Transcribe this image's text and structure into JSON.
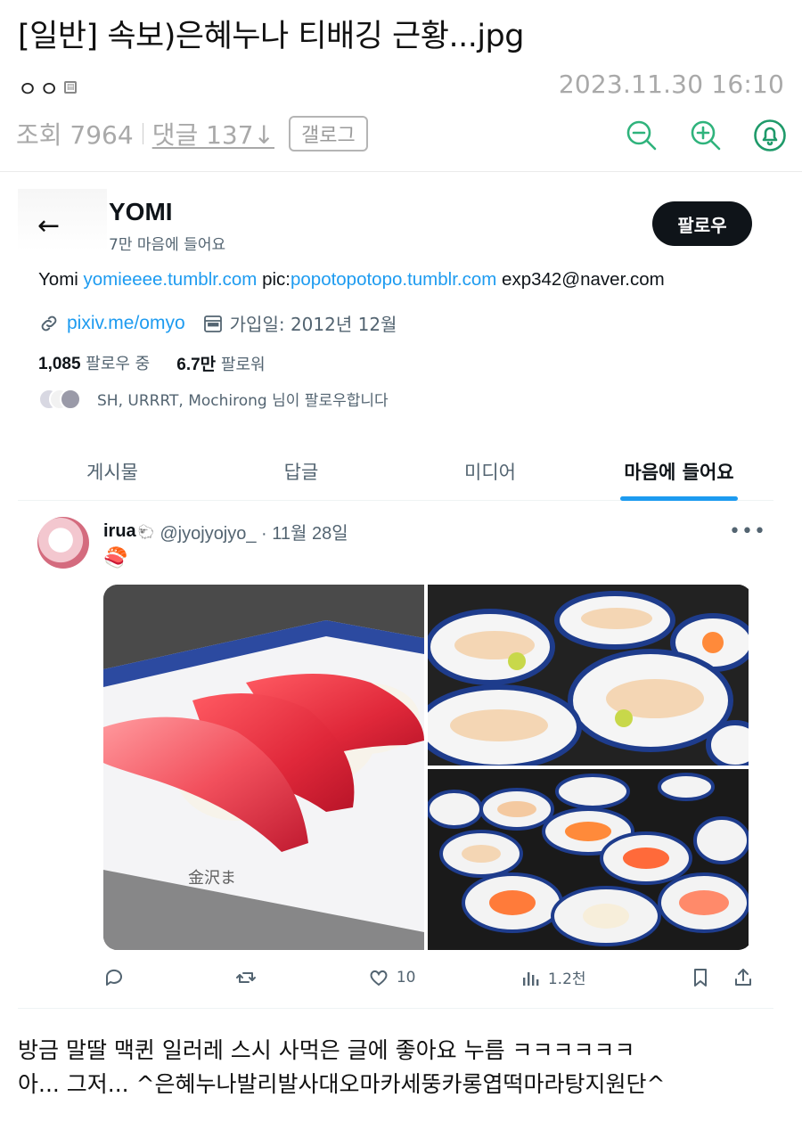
{
  "post": {
    "title": "[일반] 속보)은혜누나 티배깅 근황...jpg",
    "author": "ㅇㅇ",
    "date": "2023.11.30 16:10",
    "views": "조회 7964",
    "comments": "댓글 137↓",
    "gallog_label": "갤로그",
    "caption_line1": "방금 말딸 맥퀸 일러레 스시 사먹은 글에 좋아요 누름 ㅋㅋㅋㅋㅋㅋ",
    "caption_line2": "아... 그저... ^은혜누나발리발사대오마카세뚱카롱엽떡마라탕지원단^"
  },
  "toolbar": {
    "icons": [
      "zoom-out-icon",
      "zoom-in-icon",
      "bell-icon"
    ],
    "accent": "#2fb37c"
  },
  "profile": {
    "name": "YOMI",
    "likes_count": "7만 마음에 들어요",
    "follow_label": "팔로우",
    "bio_name": "Yomi",
    "bio_link1": "yomieeee.tumblr.com",
    "bio_pic_label": "pic:",
    "bio_link2": "popotopotopo.tumblr.com",
    "bio_email": "exp342@naver.com",
    "website": "pixiv.me/omyo",
    "joined": "가입일: 2012년 12월",
    "following_count": "1,085",
    "following_label": "팔로우 중",
    "followers_count": "6.7만",
    "followers_label": "팔로워",
    "followed_by": "SH, URRRT, Mochirong 님이 팔로우합니다"
  },
  "tabs": [
    {
      "label": "게시물"
    },
    {
      "label": "답글"
    },
    {
      "label": "미디어"
    },
    {
      "label": "마음에 들어요",
      "active": true
    }
  ],
  "tweet": {
    "user": "irua",
    "handle": "@jyojyojyo_ · 11월 28일",
    "emoji": "🍣",
    "reply_count": "",
    "retweet_count": "",
    "like_count": "10",
    "view_count": "1.2천"
  },
  "colors": {
    "link_blue": "#1d9bf0",
    "muted_gray": "#a9a9a9"
  }
}
